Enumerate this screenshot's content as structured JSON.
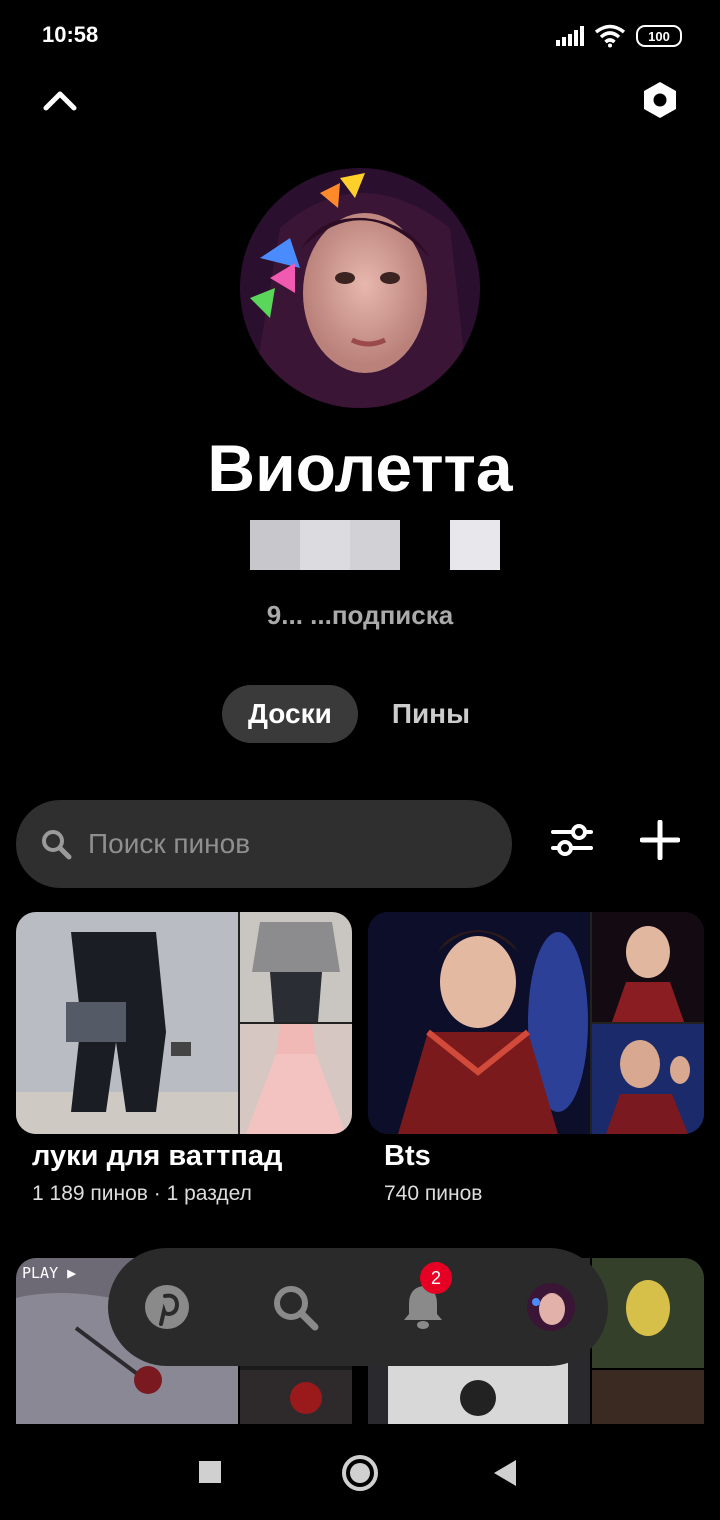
{
  "status_bar": {
    "time": "10:58",
    "battery": "100"
  },
  "profile": {
    "name": "Виолетта",
    "stats": "9... ...подписка"
  },
  "tabs": [
    {
      "label": "Доски",
      "active": true
    },
    {
      "label": "Пины",
      "active": false
    }
  ],
  "search": {
    "placeholder": "Поиск пинов"
  },
  "boards": [
    {
      "title": "луки для ваттпад",
      "meta": "1 189 пинов · 1 раздел"
    },
    {
      "title": "Bts",
      "meta": "740 пинов"
    }
  ],
  "row2_overlay_text": "PLAY ▶",
  "bottom_nav": {
    "notifications_badge": "2"
  },
  "icons": [
    "chevron-up-icon",
    "settings-hex-icon",
    "search-icon",
    "filter-icon",
    "plus-icon",
    "pinterest-icon",
    "bell-icon",
    "profile-avatar-icon",
    "square-nav-icon",
    "home-nav-icon",
    "back-nav-icon"
  ],
  "colors": {
    "background": "#000000",
    "surface": "#2f2f2f",
    "accent": "#e60023"
  }
}
